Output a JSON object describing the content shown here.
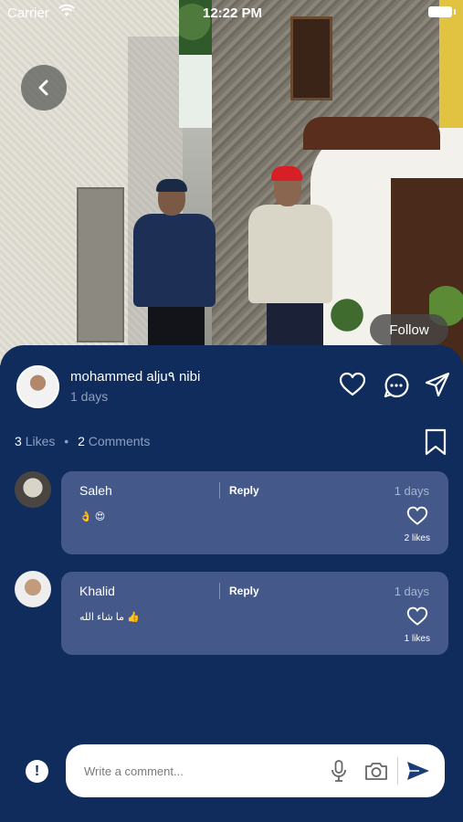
{
  "status_bar": {
    "carrier": "Carrier",
    "time": "12:22 PM"
  },
  "post": {
    "follow_label": "Follow",
    "author": "mohammed alju٩ nibi",
    "time_ago": "1 days",
    "likes_count": "3",
    "likes_label": "Likes",
    "comments_count": "2",
    "comments_label": "Comments"
  },
  "comments": [
    {
      "name": "Saleh",
      "reply_label": "Reply",
      "time": "1 days",
      "text": "👌 😍",
      "likes": "2 likes"
    },
    {
      "name": "Khalid",
      "reply_label": "Reply",
      "time": "1 days",
      "text": "ما شاء الله 👍",
      "likes": "1 likes"
    }
  ],
  "composer": {
    "placeholder": "Write a comment..."
  },
  "colors": {
    "background": "#0e2a5a",
    "comment_bubble": "#44598a",
    "accent": "#0f2c5c"
  },
  "icons": [
    "chevron-left-icon",
    "wifi-icon",
    "battery-icon",
    "heart-icon",
    "comment-icon",
    "send-icon",
    "bookmark-icon",
    "alert-icon",
    "microphone-icon",
    "camera-icon"
  ]
}
